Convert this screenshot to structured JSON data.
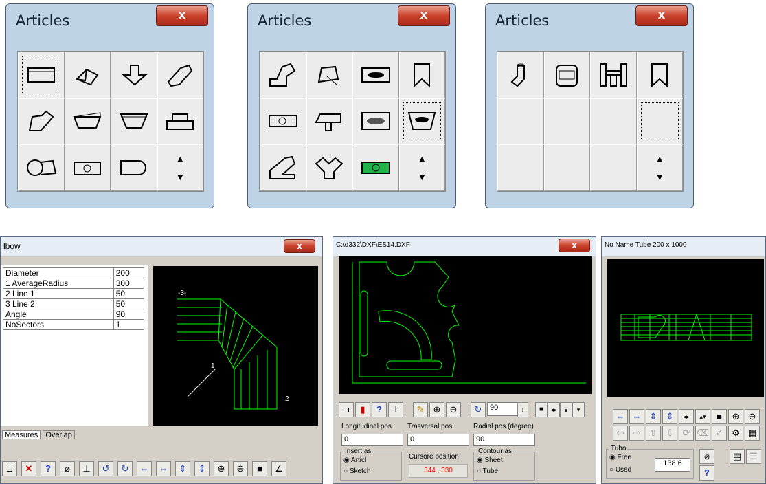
{
  "palette1": {
    "title": "Articles",
    "close": "x"
  },
  "palette2": {
    "title": "Articles",
    "close": "x"
  },
  "palette3": {
    "title": "Articles",
    "close": "x"
  },
  "elbow": {
    "title": "lbow",
    "close": "x",
    "params": [
      {
        "name": "Diameter",
        "value": "200"
      },
      {
        "name": "1 AverageRadius",
        "value": "300"
      },
      {
        "name": "2 Line  1",
        "value": "50"
      },
      {
        "name": "3 Line  2",
        "value": "50"
      },
      {
        "name": "Angle",
        "value": "90"
      },
      {
        "name": "NoSectors",
        "value": "1"
      }
    ],
    "tabs": [
      "Measures",
      "Overlap"
    ],
    "drawing_labels": {
      "l3": "-3-",
      "l1": "1",
      "l2": "2"
    }
  },
  "dxf": {
    "title": "C:\\d332\\DXF\\ES14.DXF",
    "close": "x",
    "rotation_value": "90",
    "longitudinal_label": "Longitudinal pos.",
    "longitudinal_value": "0",
    "trasversal_label": "Trasversal pos.",
    "trasversal_value": "0",
    "radial_label": "Radial pos.(degree)",
    "radial_value": "90",
    "insert_as_label": "Insert as",
    "insert_opt1": "Articl",
    "insert_opt2": "Sketch",
    "cursor_label": "Cursore position",
    "cursor_value": "344 ,  330",
    "contour_label": "Contour as",
    "contour_opt1": "Sheet",
    "contour_opt2": "Tube"
  },
  "tube": {
    "title": "No Name  Tube 200 x 1000",
    "group_label": "Tubo",
    "opt_free": "Free",
    "opt_used": "Used",
    "value": "138.6",
    "help": "?"
  },
  "colors": {
    "drawing": "#00ff00",
    "canvas": "#000000",
    "window_bg": "#d4d0c8",
    "error_text": "#ff0000"
  }
}
